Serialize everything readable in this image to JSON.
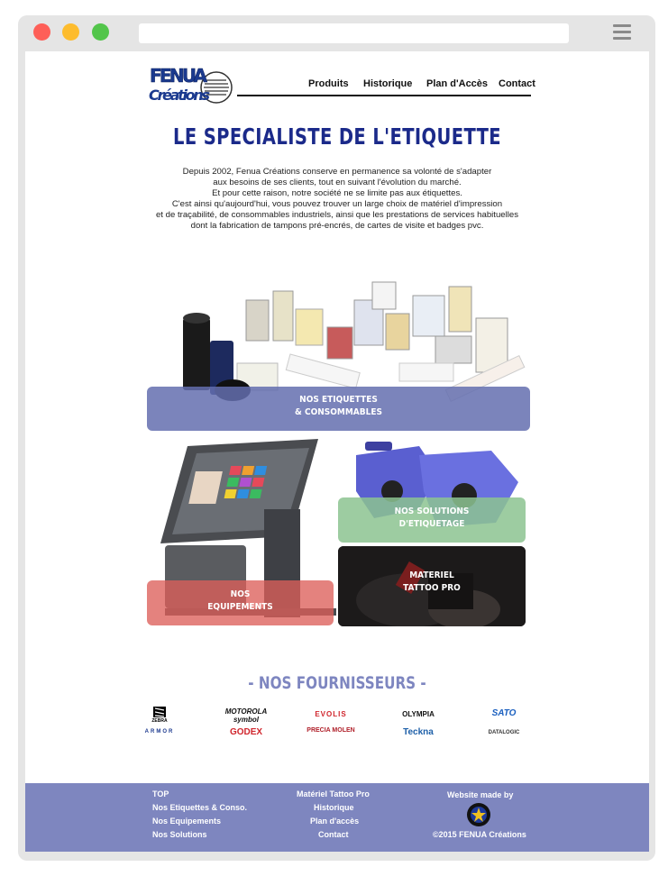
{
  "header": {
    "logo_text_top": "FENUA",
    "logo_text_bottom": "Créations",
    "nav": [
      "Produits",
      "Historique",
      "Plan d'Accès",
      "Contact"
    ]
  },
  "hero": {
    "title": "LE SPECIALISTE DE L'ETIQUETTE",
    "intro_lines": [
      "Depuis 2002, Fenua Créations conserve en permanence sa volonté de s'adapter",
      "aux besoins de ses clients, tout en suivant l'évolution du marché.",
      "Et pour cette raison, notre société ne se limite pas aux étiquettes.",
      "C'est ainsi qu'aujourd'hui, vous pouvez trouver un large choix de matériel d'impression",
      "et de traçabilité, de consommables industriels, ainsi que les prestations de services habituelles",
      "dont la fabrication de tampons pré-encrés, de cartes de visite et badges pvc."
    ]
  },
  "tiles": {
    "etiquettes": [
      "NOS ETIQUETTES",
      "& CONSOMMABLES"
    ],
    "equipements": [
      "NOS",
      "EQUIPEMENTS"
    ],
    "solutions": [
      "NOS SOLUTIONS",
      "D'ETIQUETAGE"
    ],
    "tattoo": [
      "MATERIEL",
      "TATTOO PRO"
    ]
  },
  "suppliers": {
    "title": "-  NOS FOURNISSEURS  -",
    "brands_row1": [
      "ZEBRA",
      "MOTOROLA symbol",
      "EVOLIS",
      "OLYMPIA",
      "SATO"
    ],
    "brands_row2": [
      "ARMOR",
      "GODEX",
      "PRECIA MOLEN",
      "Teckna",
      "DATALOGIC"
    ]
  },
  "footer": {
    "col1": [
      "TOP",
      "Nos  Etiquettes  &  Conso.",
      "Nos  Equipements",
      "Nos  Solutions"
    ],
    "col2": [
      "Matériel  Tattoo  Pro",
      "Historique",
      "Plan d'accès",
      "Contact"
    ],
    "made_by": "Website made by",
    "copyright": "©2015   FENUA Créations"
  },
  "colors": {
    "title_blue": "#1b2a8a",
    "footer_bg": "#7e86bf",
    "tile_blue": "#646eaf",
    "tile_red": "#dc5f5a",
    "tile_green": "#8cc391"
  }
}
